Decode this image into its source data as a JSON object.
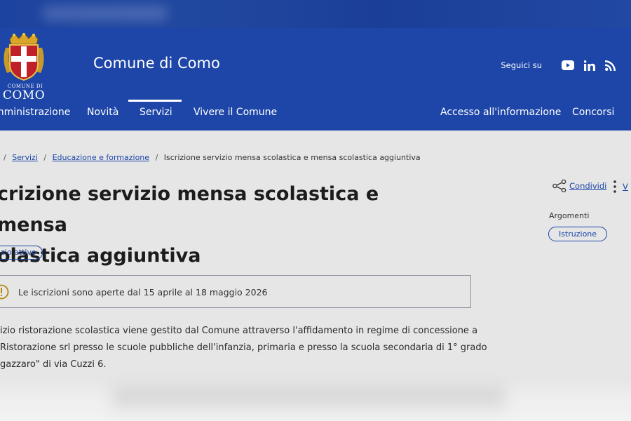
{
  "header": {
    "site_title": "Comune di Como",
    "logo_caption_small": "COMUNE DI",
    "logo_caption_big": "COMO",
    "social_label": "Seguici su",
    "social_icons": [
      "youtube-icon",
      "linkedin-icon",
      "rss-icon"
    ],
    "brand_color": "#1d46a8"
  },
  "nav": {
    "items": [
      {
        "label": "mministrazione"
      },
      {
        "label": "Novità"
      },
      {
        "label": "Servizi",
        "active": true
      },
      {
        "label": "Vivere il Comune"
      },
      {
        "label": "Accesso all'informazione"
      },
      {
        "label": "Concorsi"
      }
    ]
  },
  "breadcrumb": {
    "items": [
      "Servizi",
      "Educazione e formazione",
      "Iscrizione servizio mensa scolastica e mensa scolastica aggiuntiva"
    ]
  },
  "page": {
    "title_line1": "crizione servizio mensa scolastica e mensa",
    "title_line2": "olastica aggiuntiva",
    "status": "zio attivo",
    "alert_text": "Le iscrizioni sono aperte dal 15 aprile al 18 maggio 2026",
    "description": [
      "izio ristorazione scolastica viene gestito dal Comune attraverso l'affidamento in regime di concessione a",
      "Ristorazione srl presso le scuole pubbliche dell'infanzia, primaria e presso la scuola secondaria di 1° grado",
      "gazzaro\" di via Cuzzi 6."
    ]
  },
  "sidebar": {
    "share_label": "Condividi",
    "more_label": "V",
    "topics_label": "Argomenti",
    "topic": "Istruzione"
  }
}
